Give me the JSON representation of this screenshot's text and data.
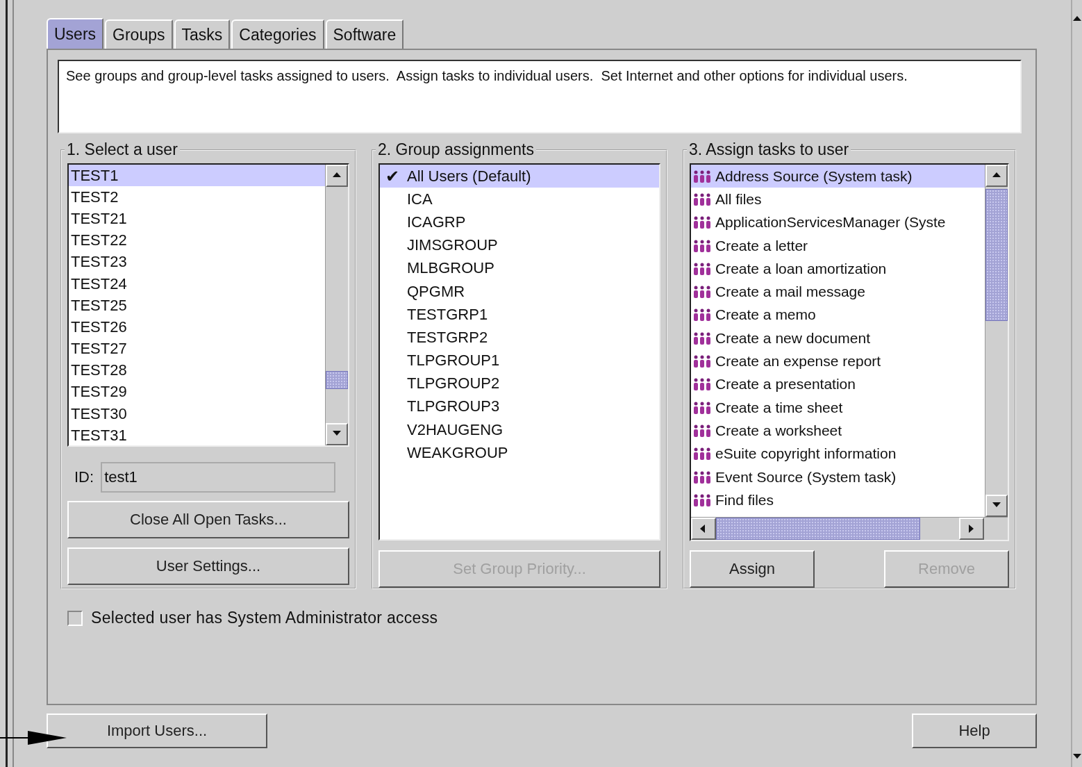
{
  "tabs": [
    {
      "label": "Users",
      "selected": true
    },
    {
      "label": "Groups",
      "selected": false
    },
    {
      "label": "Tasks",
      "selected": false
    },
    {
      "label": "Categories",
      "selected": false
    },
    {
      "label": "Software",
      "selected": false
    }
  ],
  "description": "See groups and group-level tasks assigned to users.  Assign tasks to individual users.  Set Internet and other options for individual users.",
  "user_panel": {
    "title": "1. Select a user",
    "users": [
      {
        "label": "TEST1",
        "selected": true
      },
      {
        "label": "TEST2",
        "selected": false
      },
      {
        "label": "TEST21",
        "selected": false
      },
      {
        "label": "TEST22",
        "selected": false
      },
      {
        "label": "TEST23",
        "selected": false
      },
      {
        "label": "TEST24",
        "selected": false
      },
      {
        "label": "TEST25",
        "selected": false
      },
      {
        "label": "TEST26",
        "selected": false
      },
      {
        "label": "TEST27",
        "selected": false
      },
      {
        "label": "TEST28",
        "selected": false
      },
      {
        "label": "TEST29",
        "selected": false
      },
      {
        "label": "TEST30",
        "selected": false
      },
      {
        "label": "TEST31",
        "selected": false
      }
    ],
    "id_label": "ID:",
    "id_value": "test1",
    "buttons": [
      {
        "label": "Close All Open Tasks...",
        "disabled": false
      },
      {
        "label": "User Settings...",
        "disabled": false
      }
    ]
  },
  "group_panel": {
    "title": "2. Group assignments",
    "check_mark": "✔",
    "groups": [
      {
        "label": "All Users (Default)",
        "selected": true,
        "checked": true
      },
      {
        "label": "ICA",
        "selected": false,
        "checked": false
      },
      {
        "label": "ICAGRP",
        "selected": false,
        "checked": false
      },
      {
        "label": "JIMSGROUP",
        "selected": false,
        "checked": false
      },
      {
        "label": "MLBGROUP",
        "selected": false,
        "checked": false
      },
      {
        "label": "QPGMR",
        "selected": false,
        "checked": false
      },
      {
        "label": "TESTGRP1",
        "selected": false,
        "checked": false
      },
      {
        "label": "TESTGRP2",
        "selected": false,
        "checked": false
      },
      {
        "label": "TLPGROUP1",
        "selected": false,
        "checked": false
      },
      {
        "label": "TLPGROUP2",
        "selected": false,
        "checked": false
      },
      {
        "label": "TLPGROUP3",
        "selected": false,
        "checked": false
      },
      {
        "label": "V2HAUGENG",
        "selected": false,
        "checked": false
      },
      {
        "label": "WEAKGROUP",
        "selected": false,
        "checked": false
      }
    ],
    "button": {
      "label": "Set Group Priority...",
      "disabled": true
    }
  },
  "task_panel": {
    "title": "3. Assign tasks to user",
    "tasks": [
      {
        "label": "Address Source (System task)",
        "selected": true
      },
      {
        "label": "All files",
        "selected": false
      },
      {
        "label": "ApplicationServicesManager (Syste",
        "selected": false
      },
      {
        "label": "Create a letter",
        "selected": false
      },
      {
        "label": "Create a loan amortization",
        "selected": false
      },
      {
        "label": "Create a mail message",
        "selected": false
      },
      {
        "label": "Create a memo",
        "selected": false
      },
      {
        "label": "Create a new document",
        "selected": false
      },
      {
        "label": "Create an expense report",
        "selected": false
      },
      {
        "label": "Create a presentation",
        "selected": false
      },
      {
        "label": "Create a time sheet",
        "selected": false
      },
      {
        "label": "Create a worksheet",
        "selected": false
      },
      {
        "label": "eSuite copyright information",
        "selected": false
      },
      {
        "label": "Event Source (System task)",
        "selected": false
      },
      {
        "label": "Find files",
        "selected": false
      }
    ],
    "buttons": [
      {
        "label": "Assign",
        "disabled": false
      },
      {
        "label": "Remove",
        "disabled": true
      }
    ]
  },
  "admin_checkbox": {
    "label": "Selected user has System Administrator access",
    "checked": false
  },
  "footer_buttons": [
    {
      "label": "Import Users...",
      "disabled": false
    },
    {
      "label": "Help",
      "disabled": false
    }
  ]
}
